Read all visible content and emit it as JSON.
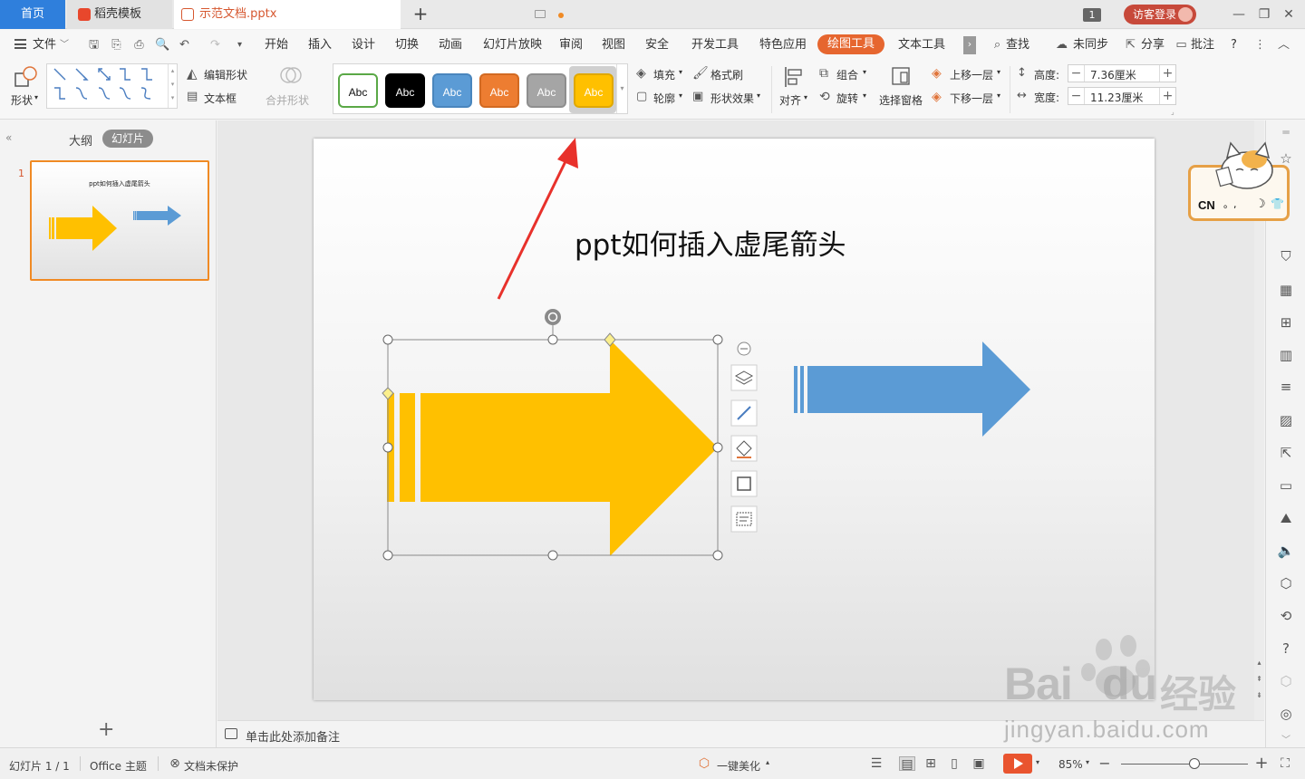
{
  "tabs": {
    "home": "首页",
    "template": "稻壳模板",
    "document": "示范文档.pptx",
    "page_count": "1",
    "login": "访客登录"
  },
  "menu": {
    "file": "文件",
    "items": [
      "开始",
      "插入",
      "设计",
      "切换",
      "动画",
      "幻灯片放映",
      "审阅",
      "视图",
      "安全",
      "开发工具",
      "特色应用",
      "绘图工具",
      "文本工具"
    ],
    "find": "查找",
    "sync": "未同步",
    "share": "分享",
    "comment": "批注",
    "help": "?"
  },
  "ribbon": {
    "shape": "形状",
    "edit_shape": "编辑形状",
    "text_box": "文本框",
    "merge_shape": "合并形状",
    "style_swatches": [
      {
        "label": "Abc",
        "bg": "#ffffff",
        "border": "#5aa846",
        "fg": "#111111"
      },
      {
        "label": "Abc",
        "bg": "#000000",
        "border": "#000000",
        "fg": "#ffffff"
      },
      {
        "label": "Abc",
        "bg": "#5b9bd5",
        "border": "#4a86bd",
        "fg": "#ffffff"
      },
      {
        "label": "Abc",
        "bg": "#ed7d31",
        "border": "#d26a22",
        "fg": "#ffffff"
      },
      {
        "label": "Abc",
        "bg": "#a5a5a5",
        "border": "#8e8e8e",
        "fg": "#ffffff"
      },
      {
        "label": "Abc",
        "bg": "#ffc000",
        "border": "#e0a800",
        "fg": "#ffffff"
      }
    ],
    "fill": "填充",
    "outline": "轮廓",
    "format_painter": "格式刷",
    "shape_effects": "形状效果",
    "align": "对齐",
    "group": "组合",
    "rotate": "旋转",
    "selection_pane": "选择窗格",
    "bring_forward": "上移一层",
    "send_backward": "下移一层",
    "height_label": "高度:",
    "height_value": "7.36厘米",
    "width_label": "宽度:",
    "width_value": "11.23厘米"
  },
  "left_panel": {
    "outline_tab": "大纲",
    "slides_tab": "幻灯片",
    "thumb_number": "1",
    "thumb_title": "ppt如何插入虚尾箭头"
  },
  "slide": {
    "title": "ppt如何插入虚尾箭头"
  },
  "notes": {
    "placeholder": "单击此处添加备注"
  },
  "statusbar": {
    "slide_info": "幻灯片 1 / 1",
    "theme": "Office 主题",
    "protect": "文档未保护",
    "beautify": "一键美化",
    "zoom": "85%",
    "zoom_level": 0.58
  },
  "ime": {
    "text": "CN",
    "punct": "。,"
  },
  "watermark": {
    "brand": "Bai",
    "brand2": "du",
    "jingyan": "经验",
    "url": "jingyan.baidu.com"
  },
  "colors": {
    "accent": "#e6662f",
    "arrow_yellow": "#ffc000",
    "arrow_blue": "#5b9bd5",
    "home_tab": "#2f7fdc",
    "annotation_red": "#e8312b"
  }
}
